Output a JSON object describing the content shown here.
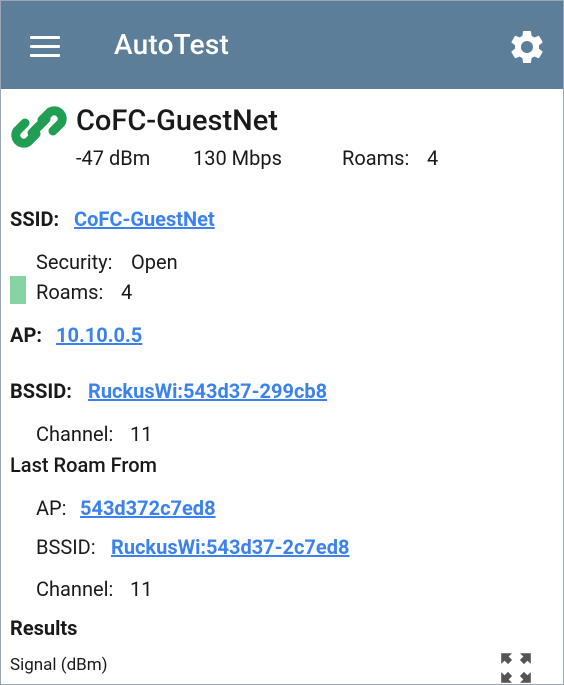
{
  "appbar": {
    "title": "AutoTest",
    "menu_icon": "hamburger-menu-icon",
    "settings_icon": "gear-icon",
    "color": "#5c7e99"
  },
  "network": {
    "name": "CoFC-GuestNet",
    "signal": "-47 dBm",
    "rate": "130 Mbps",
    "roams_label": "Roams:",
    "roams_value": "4",
    "icon": "chain-link-icon",
    "icon_color": "#1f9e54"
  },
  "ssid": {
    "label": "SSID:",
    "value": "CoFC-GuestNet",
    "security_label": "Security:",
    "security_value": "Open",
    "roams_label": "Roams:",
    "roams_value": "4"
  },
  "ap": {
    "label": "AP:",
    "value": "10.10.0.5",
    "bssid_label": "BSSID:",
    "bssid_value": "RuckusWi:543d37-299cb8",
    "channel_label": "Channel:",
    "channel_value": "11"
  },
  "last_roam": {
    "heading": "Last Roam From",
    "ap_label": "AP:",
    "ap_value": "543d372c7ed8",
    "bssid_label": "BSSID:",
    "bssid_value": "RuckusWi:543d37-2c7ed8",
    "channel_label": "Channel:",
    "channel_value": "11"
  },
  "results": {
    "heading": "Results",
    "signal_label": "Signal (dBm)",
    "expand_icon": "expand-icon"
  },
  "colors": {
    "link": "#3b82f0",
    "accent_bar": "#86d3a3"
  }
}
